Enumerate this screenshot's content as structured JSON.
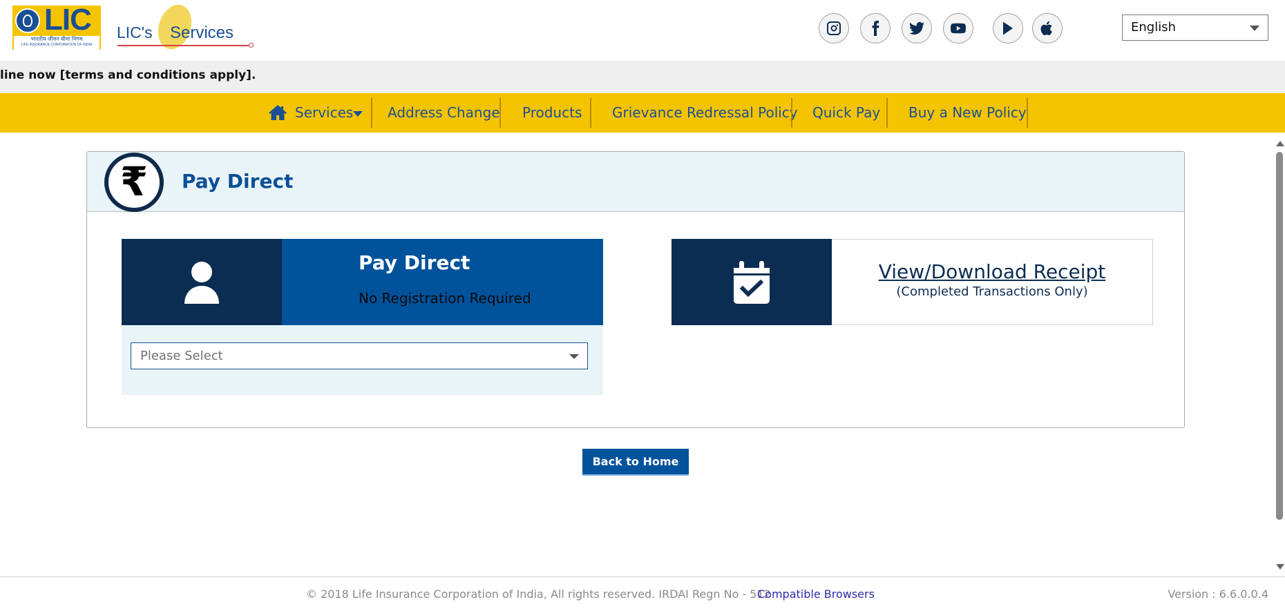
{
  "header": {
    "logo_text": "LIC",
    "logo_hindi": "भारतीय जीवन बीमा निगम",
    "logo_english": "LIFE INSURANCE CORPORATION OF INDIA",
    "eservices_prefix": "LIC's",
    "eservices_suffix": "Services",
    "social_icons": [
      "instagram-icon",
      "facebook-icon",
      "twitter-icon",
      "youtube-icon",
      "play-store-icon",
      "apple-icon"
    ],
    "language": "English"
  },
  "marquee": {
    "text": "line now [terms and conditions apply]."
  },
  "nav": {
    "services": "Services",
    "address_change": "Address Change",
    "products": "Products",
    "grievance": "Grievance Redressal Policy",
    "quick_pay": "Quick Pay",
    "buy_policy": "Buy a New Policy"
  },
  "panel": {
    "title": "Pay Direct",
    "icon_symbol": "₹"
  },
  "pay_direct_card": {
    "title": "Pay Direct",
    "subtitle": "No Registration Required"
  },
  "select": {
    "value": "Please Select"
  },
  "receipt_card": {
    "title": "View/Download Receipt",
    "subtitle": "(Completed Transactions Only)"
  },
  "back_button": "Back to Home",
  "footer": {
    "copyright": "© 2018 Life Insurance Corporation of India, All rights reserved. IRDAI Regn No - 512",
    "compatible": "Compatible Browsers",
    "version": "Version : 6.6.0.0.4"
  },
  "colors": {
    "brand_yellow": "#f5c400",
    "brand_blue": "#00529b",
    "navy": "#0c2d52",
    "panel_tint": "#e8f4f7"
  }
}
